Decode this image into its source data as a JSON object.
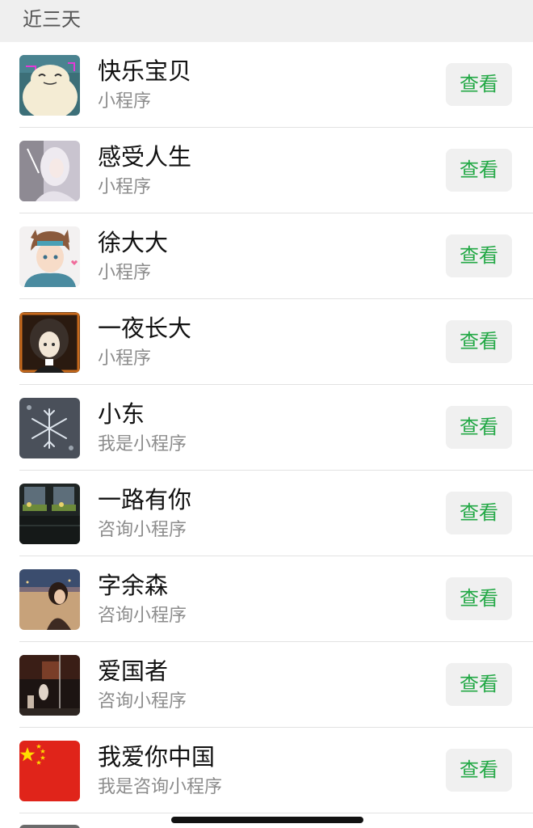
{
  "section": {
    "title": "近三天"
  },
  "items": [
    {
      "title": "快乐宝贝",
      "subtitle": "小程序",
      "button": "查看",
      "avatar": "snorlax-avatar"
    },
    {
      "title": "感受人生",
      "subtitle": "小程序",
      "button": "查看",
      "avatar": "white-hair-avatar"
    },
    {
      "title": "徐大大",
      "subtitle": "小程序",
      "button": "查看",
      "avatar": "anime-boy-avatar"
    },
    {
      "title": "一夜长大",
      "subtitle": "小程序",
      "button": "查看",
      "avatar": "dark-hair-girl-avatar"
    },
    {
      "title": "小东",
      "subtitle": "我是小程序",
      "button": "查看",
      "avatar": "snowflake-avatar"
    },
    {
      "title": "一路有你",
      "subtitle": "咨询小程序",
      "button": "查看",
      "avatar": "window-plants-avatar"
    },
    {
      "title": "字余森",
      "subtitle": "咨询小程序",
      "button": "查看",
      "avatar": "girl-city-avatar"
    },
    {
      "title": "爱国者",
      "subtitle": "咨询小程序",
      "button": "查看",
      "avatar": "night-street-avatar"
    },
    {
      "title": "我爱你中国",
      "subtitle": "我是咨询小程序",
      "button": "查看",
      "avatar": "china-flag-avatar"
    }
  ],
  "colors": {
    "accent": "#22a845",
    "button_bg": "#f0f0f0",
    "header_bg": "#efefef",
    "subtitle": "#8c8c8c",
    "divider": "#e2e2e2"
  }
}
